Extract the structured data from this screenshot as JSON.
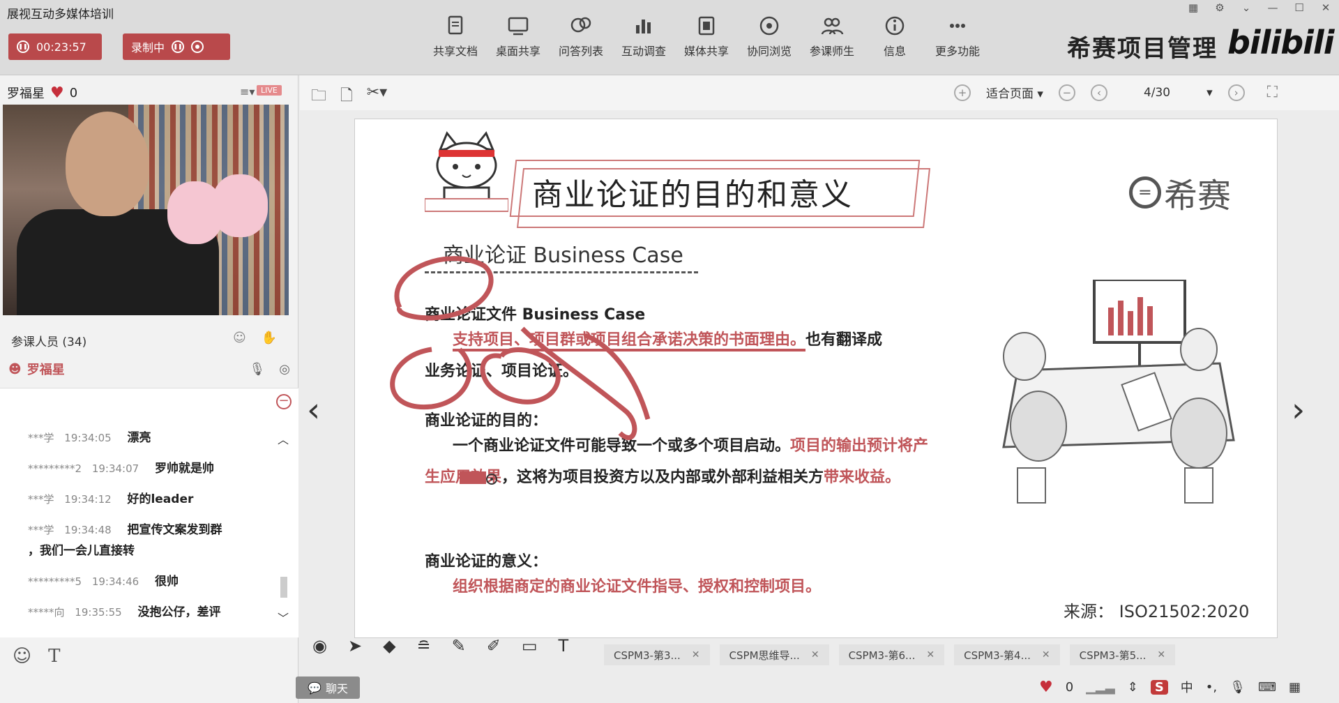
{
  "app": {
    "title": "展视互动多媒体培训",
    "timer": "00:23:57",
    "recording_label": "录制中"
  },
  "toolbar": [
    {
      "label": "共享文档",
      "icon": "document-icon"
    },
    {
      "label": "桌面共享",
      "icon": "desktop-icon"
    },
    {
      "label": "问答列表",
      "icon": "qa-icon"
    },
    {
      "label": "互动调查",
      "icon": "chart-icon"
    },
    {
      "label": "媒体共享",
      "icon": "film-icon"
    },
    {
      "label": "协同浏览",
      "icon": "compass-icon"
    },
    {
      "label": "参课师生",
      "icon": "users-icon"
    },
    {
      "label": "信息",
      "icon": "info-icon"
    },
    {
      "label": "更多功能",
      "icon": "more-icon"
    }
  ],
  "brand": {
    "name": "希赛项目管理",
    "platform": "bilibili"
  },
  "speaker": {
    "name": "罗福星",
    "likes": "0",
    "live_badge": "LIVE"
  },
  "participants": {
    "label": "参课人员 (34)",
    "current_user": "罗福星"
  },
  "chat": {
    "messages": [
      {
        "user": "***学",
        "time": "19:34:05",
        "text": "漂亮"
      },
      {
        "user": "*********2",
        "time": "19:34:07",
        "text": "罗帅就是帅"
      },
      {
        "user": "***学",
        "time": "19:34:12",
        "text": "好的leader"
      },
      {
        "user": "***学",
        "time": "19:34:48",
        "text": "把宣传文案发到群",
        "text2": "，我们一会儿直接转"
      },
      {
        "user": "*********5",
        "time": "19:34:46",
        "text": "很帅"
      },
      {
        "user": "*****向",
        "time": "19:35:55",
        "text": "没抱公仔，差评"
      }
    ],
    "chat_button": "聊天"
  },
  "viewer": {
    "fit_label": "适合页面",
    "page": "4/30"
  },
  "slide": {
    "title": "商业论证的目的和意义",
    "logo": "希赛",
    "subtitle": "商业论证 Business Case",
    "sec1_heading": "商业论证文件 Business Case",
    "sec1_p1": "支持项目、项目群或项目组合承诺决策的书面理由。",
    "sec1_p1b": "也有翻译成",
    "sec1_p2": "业务论证、项目论证。",
    "sec2_heading": "商业论证的目的：",
    "sec2_a": "一个商业论证文件可能导致一个或多个项目启动。",
    "sec2_b": "项目的输出预计将产生应用效果",
    "sec2_c": "，这将为项目投资方以及内部或外部利益相关方",
    "sec2_d": "带来收益。",
    "sec3_heading": "商业论证的意义：",
    "sec3_text": "组织根据商定的商业论证文件指导、授权和控制项目。",
    "source": "来源：  ISO21502:2020"
  },
  "tabs": [
    {
      "label": "CSPM3-第3..."
    },
    {
      "label": "CSPM思维导..."
    },
    {
      "label": "CSPM3-第6..."
    },
    {
      "label": "CSPM3-第4..."
    },
    {
      "label": "CSPM3-第5..."
    }
  ],
  "status": {
    "likes": "0",
    "ime": "中"
  },
  "colors": {
    "accent": "#b9494b",
    "highlight": "#c05559"
  }
}
